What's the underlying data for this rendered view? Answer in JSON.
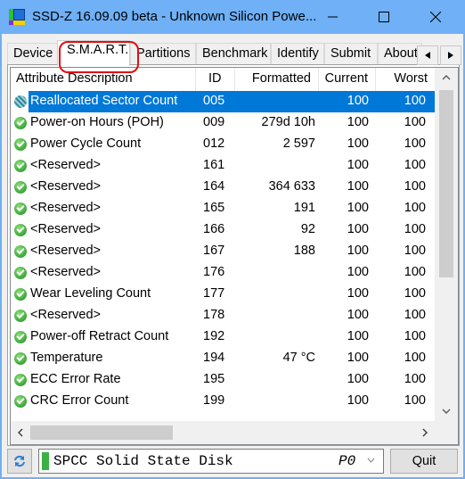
{
  "window": {
    "title": "SSD-Z 16.09.09 beta - Unknown Silicon Powe...",
    "controls": {
      "minimize": "—",
      "maximize": "☐",
      "close": "✕"
    }
  },
  "tabs": [
    {
      "label": "Device",
      "active": false
    },
    {
      "label": "S.M.A.R.T.",
      "active": true,
      "highlighted": true
    },
    {
      "label": "Partitions",
      "active": false
    },
    {
      "label": "Benchmark",
      "active": false
    },
    {
      "label": "Identify",
      "active": false
    },
    {
      "label": "Submit",
      "active": false
    },
    {
      "label": "About",
      "active": false
    }
  ],
  "tab_scroll": {
    "left": "◀",
    "right": "▶"
  },
  "table": {
    "columns": [
      "Attribute Description",
      "ID",
      "Formatted",
      "Current",
      "Worst"
    ],
    "rows": [
      {
        "desc": "Reallocated Sector Count",
        "id": "005",
        "formatted": "",
        "current": "100",
        "worst": "100",
        "selected": true
      },
      {
        "desc": "Power-on Hours (POH)",
        "id": "009",
        "formatted": "279d 10h",
        "current": "100",
        "worst": "100"
      },
      {
        "desc": "Power Cycle Count",
        "id": "012",
        "formatted": "2 597",
        "current": "100",
        "worst": "100"
      },
      {
        "desc": "<Reserved>",
        "id": "161",
        "formatted": "",
        "current": "100",
        "worst": "100"
      },
      {
        "desc": "<Reserved>",
        "id": "164",
        "formatted": "364 633",
        "current": "100",
        "worst": "100"
      },
      {
        "desc": "<Reserved>",
        "id": "165",
        "formatted": "191",
        "current": "100",
        "worst": "100"
      },
      {
        "desc": "<Reserved>",
        "id": "166",
        "formatted": "92",
        "current": "100",
        "worst": "100"
      },
      {
        "desc": "<Reserved>",
        "id": "167",
        "formatted": "188",
        "current": "100",
        "worst": "100"
      },
      {
        "desc": "<Reserved>",
        "id": "176",
        "formatted": "",
        "current": "100",
        "worst": "100"
      },
      {
        "desc": "Wear Leveling Count",
        "id": "177",
        "formatted": "",
        "current": "100",
        "worst": "100"
      },
      {
        "desc": "<Reserved>",
        "id": "178",
        "formatted": "",
        "current": "100",
        "worst": "100"
      },
      {
        "desc": "Power-off Retract Count",
        "id": "192",
        "formatted": "",
        "current": "100",
        "worst": "100"
      },
      {
        "desc": "Temperature",
        "id": "194",
        "formatted": "47 °C",
        "current": "100",
        "worst": "100"
      },
      {
        "desc": "ECC Error Rate",
        "id": "195",
        "formatted": "",
        "current": "100",
        "worst": "100"
      },
      {
        "desc": "CRC Error Count",
        "id": "199",
        "formatted": "",
        "current": "100",
        "worst": "100"
      }
    ]
  },
  "scrollbars": {
    "vertical": {
      "up": "˄",
      "down": "˅"
    },
    "horizontal": {
      "left": "<",
      "right": ">"
    }
  },
  "bottom": {
    "drive_name": "SPCC Solid State Disk",
    "drive_port": "P0",
    "drive_chevron": "˅",
    "quit_label": "Quit"
  },
  "colors": {
    "titlebar": "#6fb0f6",
    "selection": "#0078d7",
    "highlight_ring": "#e01010",
    "drive_led": "#3cb043"
  }
}
